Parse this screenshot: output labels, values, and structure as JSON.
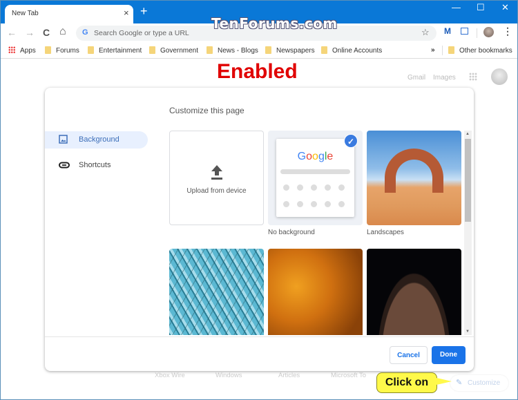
{
  "browser": {
    "tab_title": "New Tab",
    "tab_close_icon": "×",
    "new_tab_icon": "+",
    "window_controls": {
      "minimize": "—",
      "maximize": "☐",
      "close": "✕"
    },
    "nav": {
      "back": "←",
      "forward": "→",
      "reload": "C",
      "home": "⌂"
    },
    "omnibox": {
      "placeholder": "Search Google or type a URL",
      "google_g": "G"
    },
    "star_icon": "☆",
    "extension_m": "M",
    "menu_icon": "⋮",
    "watermark": "TenForums.com",
    "bookmarks": {
      "apps": "Apps",
      "items": [
        "Forums",
        "Entertainment",
        "Government",
        "News - Blogs",
        "Newspapers",
        "Online Accounts"
      ],
      "overflow": "»",
      "other": "Other bookmarks"
    }
  },
  "annotation": {
    "heading": "Enabled",
    "callout": "Click on"
  },
  "ntp": {
    "gmail": "Gmail",
    "images": "Images",
    "tiles": [
      "Xbox Wire",
      "Windows",
      "Articles",
      "Microsoft To"
    ],
    "customize_label": "Customize",
    "pencil_icon": "✎"
  },
  "dialog": {
    "title": "Customize this page",
    "menu": [
      {
        "label": "Background",
        "icon": "image-icon",
        "active": true
      },
      {
        "label": "Shortcuts",
        "icon": "link-icon",
        "active": false
      }
    ],
    "backgrounds": [
      {
        "label": "Upload from device",
        "type": "upload"
      },
      {
        "label": "No background",
        "type": "none",
        "selected": true
      },
      {
        "label": "Landscapes",
        "type": "collection"
      },
      {
        "label": "",
        "type": "collection"
      },
      {
        "label": "",
        "type": "collection"
      },
      {
        "label": "",
        "type": "collection"
      }
    ],
    "preview_google": "Google",
    "check_icon": "✓",
    "cancel_label": "Cancel",
    "done_label": "Done"
  }
}
